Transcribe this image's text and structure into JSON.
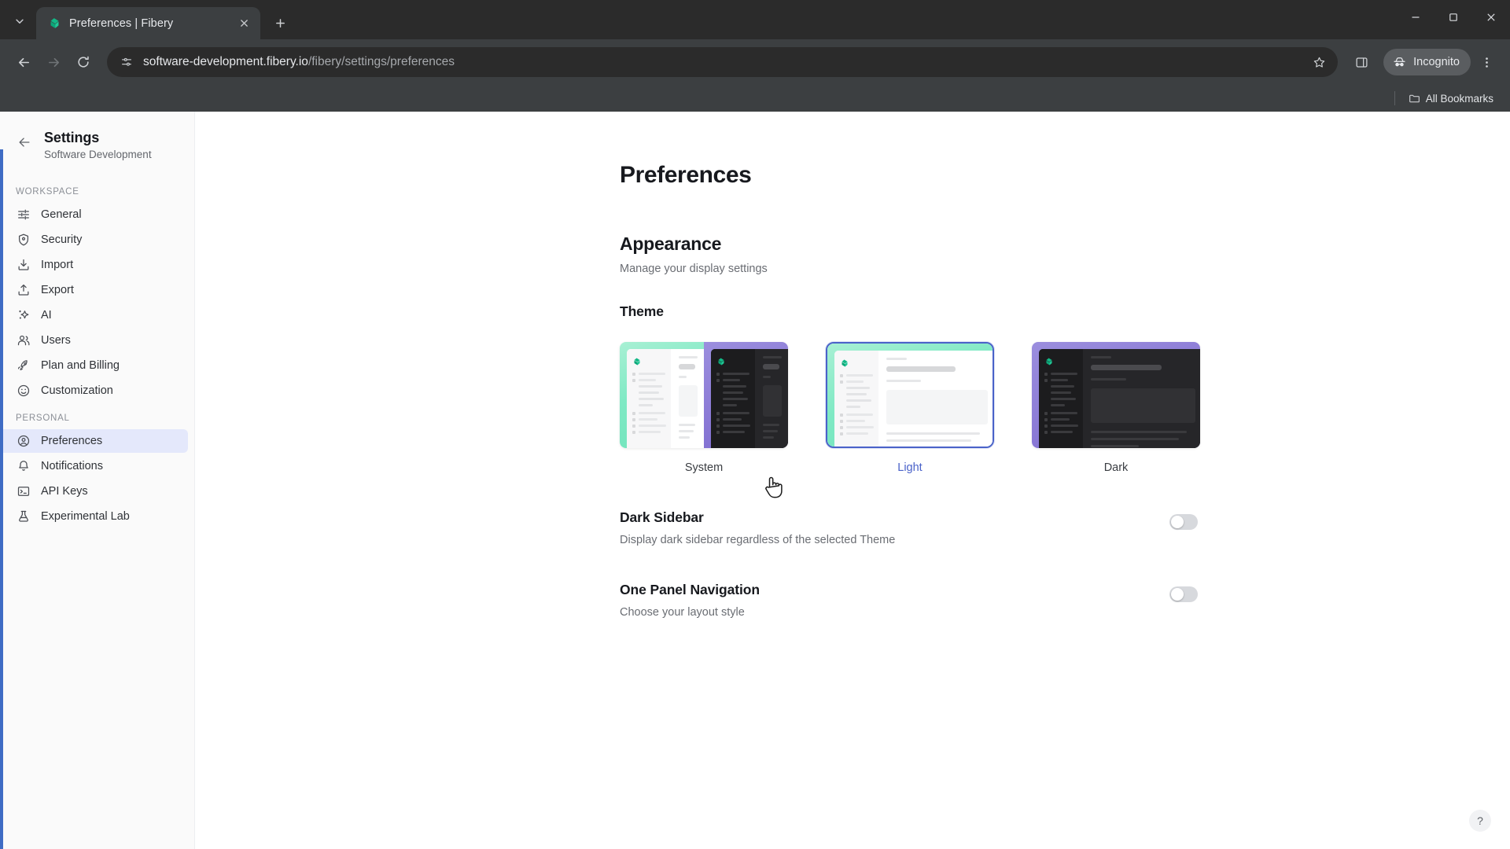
{
  "browser": {
    "tab": {
      "title": "Preferences | Fibery",
      "favicon": "fibery-logo-icon",
      "close_icon": "close-icon"
    },
    "tab_search_icon": "tab-search-chevron-icon",
    "new_tab_icon": "plus-icon",
    "window_controls": {
      "minimize": "minimize-icon",
      "maximize": "maximize-icon",
      "close": "close-icon"
    },
    "nav": {
      "back_icon": "back-arrow-icon",
      "forward_icon": "forward-arrow-icon",
      "reload_icon": "reload-icon"
    },
    "omnibox": {
      "site_info_icon": "site-settings-icon",
      "url_host": "software-development.fibery.io",
      "url_path": "/fibery/settings/preferences",
      "star_icon": "bookmark-star-icon"
    },
    "side_panel_icon": "side-panel-icon",
    "incognito": {
      "label": "Incognito",
      "icon": "incognito-icon"
    },
    "menu_icon": "three-dot-menu-icon",
    "bookmarks": {
      "all_bookmarks_label": "All Bookmarks",
      "folder_icon": "folder-icon"
    }
  },
  "sidebar": {
    "back_icon": "back-arrow-icon",
    "title": "Settings",
    "subtitle": "Software Development",
    "sections": [
      {
        "label": "WORKSPACE",
        "items": [
          {
            "label": "General",
            "icon": "sliders-icon"
          },
          {
            "label": "Security",
            "icon": "shield-icon"
          },
          {
            "label": "Import",
            "icon": "download-icon"
          },
          {
            "label": "Export",
            "icon": "upload-icon"
          },
          {
            "label": "AI",
            "icon": "sparkle-icon"
          },
          {
            "label": "Users",
            "icon": "users-icon"
          },
          {
            "label": "Plan and Billing",
            "icon": "rocket-icon"
          },
          {
            "label": "Customization",
            "icon": "smiley-icon"
          }
        ]
      },
      {
        "label": "PERSONAL",
        "items": [
          {
            "label": "Preferences",
            "icon": "user-circle-icon",
            "active": true
          },
          {
            "label": "Notifications",
            "icon": "bell-icon"
          },
          {
            "label": "API Keys",
            "icon": "terminal-icon"
          },
          {
            "label": "Experimental Lab",
            "icon": "flask-icon"
          }
        ]
      }
    ],
    "accent_color": "#3f6cc4",
    "active_bg": "#e4e8fb"
  },
  "main": {
    "page_title": "Preferences",
    "appearance": {
      "heading": "Appearance",
      "subheading": "Manage your display settings",
      "theme_label": "Theme",
      "themes": [
        {
          "id": "system",
          "label": "System",
          "selected": false
        },
        {
          "id": "light",
          "label": "Light",
          "selected": true
        },
        {
          "id": "dark",
          "label": "Dark",
          "selected": false
        }
      ],
      "selected_color": "#4a62c9"
    },
    "preferences": [
      {
        "name": "Dark Sidebar",
        "description": "Display dark sidebar regardless of the selected Theme",
        "enabled": false
      },
      {
        "name": "One Panel Navigation",
        "description": "Choose your layout style",
        "enabled": false
      }
    ],
    "help_button": "?"
  }
}
